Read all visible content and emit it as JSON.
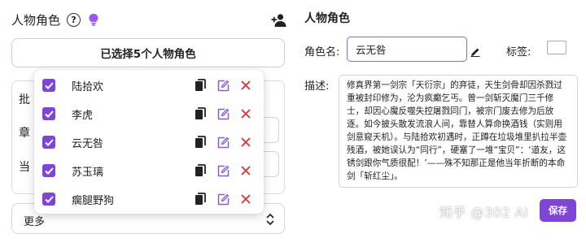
{
  "left": {
    "title": "人物角色",
    "help_icon_glyph": "?",
    "selected_button": "已选择5个人物角色",
    "behind_labels": [
      "批",
      "章",
      "当"
    ],
    "more_label": "更多",
    "characters": [
      {
        "name": "陆拾欢",
        "checked": true
      },
      {
        "name": "李虎",
        "checked": true
      },
      {
        "name": "云无咎",
        "checked": true
      },
      {
        "name": "苏玉璃",
        "checked": true
      },
      {
        "name": "瘸腿野狗",
        "checked": true
      }
    ]
  },
  "right": {
    "title": "人物角色",
    "name_label": "角色名:",
    "name_value": "云无咎",
    "tag_label": "标签:",
    "desc_label": "描述:",
    "description": "修真界第一剑宗「天衍宗」的弃徒，天生剑骨却因杀戮过重被封印修为，沦为疯癫乞丐。曾一剑斩灭魔门三千修士，却因心魔反噬失控屠戮同门，被宗门废去修为后放逐。如今披头散发流浪人间，靠替人算命换酒钱（实则用剑意窥天机）。与陆拾欢初遇时，正蹲在垃圾堆里扒拉半壶残酒，被她误认为“同行”，硬塞了一堆“宝贝”：‘道友，这锈剑跟你气质很配！’——殊不知那正是他当年折断的本命剑「斩红尘」。",
    "save_label": "保存"
  },
  "watermark": "知乎 @302 AI",
  "colors": {
    "accent": "#7e45d6",
    "input_border": "#8c62e0",
    "delete_red": "#d93636",
    "edit_purple": "#8a5bd8",
    "bulb": "#9b59f0"
  },
  "icons": {
    "help": "question-circle-icon",
    "bulb": "lightbulb-icon",
    "add_user": "add-user-icon",
    "copy": "copy-icon",
    "edit": "edit-icon",
    "delete": "close-icon",
    "pencil": "pencil-icon",
    "updown": "chevron-updown-icon"
  }
}
